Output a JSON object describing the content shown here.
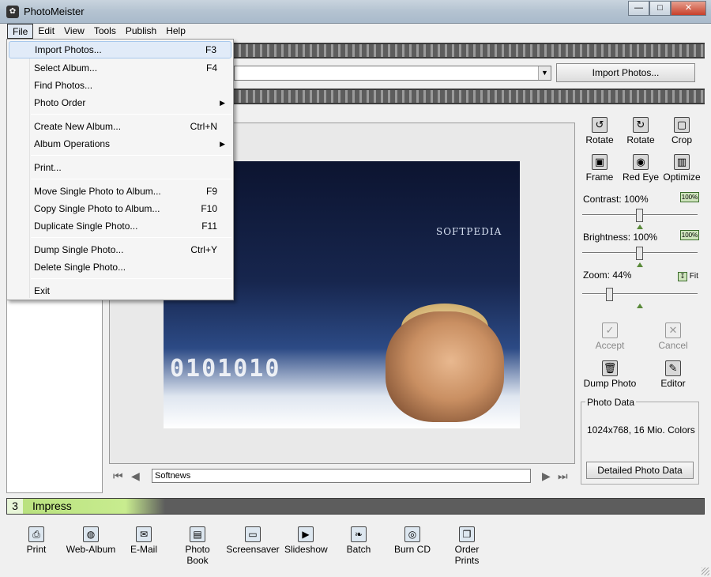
{
  "window": {
    "title": "PhotoMeister"
  },
  "menu": [
    "File",
    "Edit",
    "View",
    "Tools",
    "Publish",
    "Help"
  ],
  "file_menu": [
    {
      "label": "Import Photos...",
      "shortcut": "F3"
    },
    {
      "label": "Select Album...",
      "shortcut": "F4"
    },
    {
      "label": "Find Photos...",
      "shortcut": ""
    },
    {
      "label": "Photo Order",
      "shortcut": "",
      "submenu": true
    },
    {
      "label": "Create New Album...",
      "shortcut": "Ctrl+N"
    },
    {
      "label": "Album Operations",
      "shortcut": "",
      "submenu": true
    },
    {
      "label": "Print...",
      "shortcut": ""
    },
    {
      "label": "Move Single Photo to Album...",
      "shortcut": "F9"
    },
    {
      "label": "Copy Single Photo to Album...",
      "shortcut": "F10"
    },
    {
      "label": "Duplicate Single Photo...",
      "shortcut": "F11"
    },
    {
      "label": "Dump Single Photo...",
      "shortcut": "Ctrl+Y"
    },
    {
      "label": "Delete Single Photo...",
      "shortcut": ""
    },
    {
      "label": "Exit",
      "shortcut": ""
    }
  ],
  "toolbar": {
    "import_button": "Import Photos..."
  },
  "photo": {
    "brand": "SOFTPEDIA",
    "caption": "Softnews"
  },
  "tools": {
    "rotate_left": "Rotate",
    "rotate_right": "Rotate",
    "crop": "Crop",
    "frame": "Frame",
    "red_eye": "Red Eye",
    "optimize": "Optimize",
    "contrast_label": "Contrast: 100%",
    "brightness_label": "Brightness: 100%",
    "zoom_label": "Zoom: 44%",
    "contrast_value": 100,
    "brightness_value": 100,
    "zoom_value": 44,
    "reset_badge": "100%",
    "fit_label": "Fit",
    "accept": "Accept",
    "cancel": "Cancel",
    "dump_photo": "Dump Photo",
    "editor": "Editor"
  },
  "photo_data": {
    "legend": "Photo Data",
    "info": "1024x768, 16 Mio. Colors",
    "button": "Detailed Photo Data"
  },
  "impress": {
    "number": "3",
    "label": "Impress"
  },
  "bottom_tools": [
    "Print",
    "Web-Album",
    "E-Mail",
    "Photo Book",
    "Screensaver",
    "Slideshow",
    "Batch",
    "Burn CD",
    "Order Prints"
  ],
  "colors": {
    "accent_green": "#b7e07d",
    "menu_highlight": "#e1ebf8"
  }
}
